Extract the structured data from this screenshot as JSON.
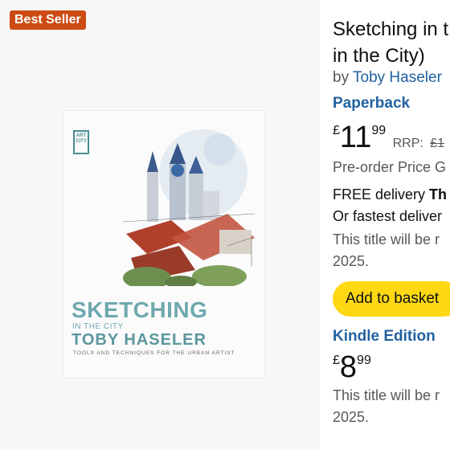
{
  "badge": "Best Seller",
  "cover": {
    "logo": "ART CITY",
    "title": "SKETCHING",
    "subtitle": "IN THE CITY",
    "author": "TOBY HASELER",
    "tagline": "TOOLS AND TECHNIQUES FOR THE URBAN ARTIST"
  },
  "product": {
    "title_line1": "Sketching in t",
    "title_line2": "in the City)",
    "by_prefix": "by",
    "author": "Toby Haseler"
  },
  "paperback": {
    "format": "Paperback",
    "currency": "£",
    "price_whole": "11",
    "price_frac": "99",
    "rrp_label": "RRP:",
    "rrp_value": "£1",
    "preorder": "Pre-order Price G",
    "delivery_prefix": "FREE delivery ",
    "delivery_bold": "Th",
    "fastest": "Or fastest deliver",
    "release_line1": "This title will be r",
    "release_line2": "2025.",
    "add_button": "Add to basket"
  },
  "kindle": {
    "format": "Kindle Edition",
    "currency": "£",
    "price_whole": "8",
    "price_frac": "99",
    "release_line1": "This title will be r",
    "release_line2": "2025."
  }
}
